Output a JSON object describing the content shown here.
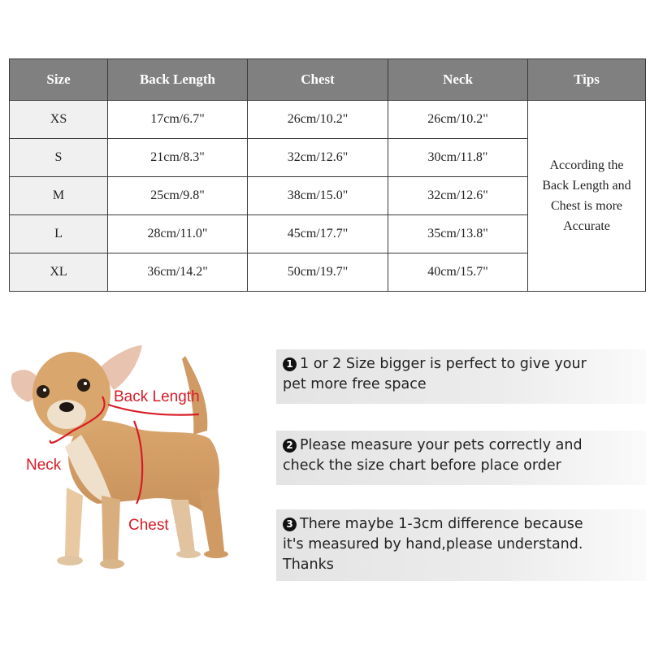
{
  "table": {
    "headers": [
      "Size",
      "Back Length",
      "Chest",
      "Neck",
      "Tips"
    ],
    "rows": [
      {
        "size": "XS",
        "back_length": "17cm/6.7\"",
        "chest": "26cm/10.2\"",
        "neck": "26cm/10.2\""
      },
      {
        "size": "S",
        "back_length": "21cm/8.3\"",
        "chest": "32cm/12.6\"",
        "neck": "30cm/11.8\""
      },
      {
        "size": "M",
        "back_length": "25cm/9.8\"",
        "chest": "38cm/15.0\"",
        "neck": "32cm/12.6\""
      },
      {
        "size": "L",
        "back_length": "28cm/11.0\"",
        "chest": "45cm/17.7\"",
        "neck": "35cm/13.8\""
      },
      {
        "size": "XL",
        "back_length": "36cm/14.2\"",
        "chest": "50cm/19.7\"",
        "neck": "40cm/15.7\""
      }
    ],
    "tips_lines": [
      "According the",
      "Back Length and",
      "Chest is more",
      "Accurate"
    ]
  },
  "diagram": {
    "labels": {
      "back_length": "Back Length",
      "neck": "Neck",
      "chest": "Chest"
    },
    "label_color": "#d81b26"
  },
  "notes": [
    {
      "number": "1",
      "lines": [
        "1 or 2 Size bigger is perfect to give your",
        "pet more free space"
      ]
    },
    {
      "number": "2",
      "lines": [
        "Please measure your pets correctly and",
        "check the size chart before place order"
      ]
    },
    {
      "number": "3",
      "lines": [
        "There maybe 1-3cm difference because",
        "it's measured by hand,please understand.",
        "Thanks"
      ]
    }
  ],
  "colors": {
    "header_bg": "#808080",
    "size_col_bg": "#f0f0f0",
    "border": "#3a3a3a"
  }
}
